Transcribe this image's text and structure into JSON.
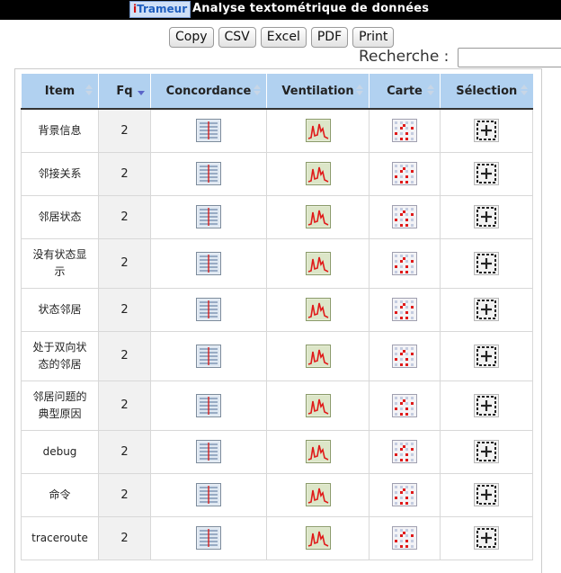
{
  "header": {
    "brand_i": "i",
    "brand_rest": "Trameur",
    "title": "Analyse textométrique de données"
  },
  "toolbar": {
    "buttons": [
      "Copy",
      "CSV",
      "Excel",
      "PDF",
      "Print"
    ]
  },
  "search": {
    "label": "Recherche :",
    "value": ""
  },
  "table": {
    "columns": [
      "Item",
      "Fq",
      "Concordance",
      "Ventilation",
      "Carte",
      "Sélection"
    ],
    "sorted_column": "Fq",
    "rows": [
      {
        "item": "背景信息",
        "fq": "2"
      },
      {
        "item": "邻接关系",
        "fq": "2"
      },
      {
        "item": "邻居状态",
        "fq": "2"
      },
      {
        "item": "没有状态显示",
        "fq": "2"
      },
      {
        "item": "状态邻居",
        "fq": "2"
      },
      {
        "item": "处于双向状态的邻居",
        "fq": "2"
      },
      {
        "item": "邻居问题的典型原因",
        "fq": "2"
      },
      {
        "item": "debug",
        "fq": "2"
      },
      {
        "item": "命令",
        "fq": "2"
      },
      {
        "item": "traceroute",
        "fq": "2"
      }
    ],
    "row_icons": [
      "concordance-icon",
      "ventilation-icon",
      "carte-icon",
      "selection-icon"
    ]
  },
  "colors": {
    "header_bg": "#b1d1f0",
    "topbar_bg": "#000000",
    "brand_red": "#d01010",
    "brand_blue": "#1f5fbf"
  }
}
